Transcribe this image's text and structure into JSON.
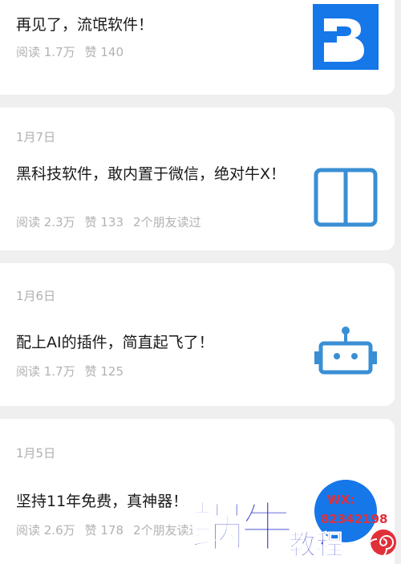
{
  "articles": [
    {
      "title": "再见了，流氓软件！",
      "reads": "阅读 1.7万",
      "likes": "赞 140",
      "thumbnail_icon": "blue-k-logo-icon"
    },
    {
      "date": "1月7日",
      "title": "黑科技软件，敢内置于微信，绝对牛X！",
      "reads": "阅读 2.3万",
      "likes": "赞 133",
      "friends": "2个朋友读过",
      "thumbnail_icon": "book-icon"
    },
    {
      "date": "1月6日",
      "title": "配上AI的插件，简直起飞了！",
      "reads": "阅读 1.7万",
      "likes": "赞 125",
      "thumbnail_icon": "robot-icon"
    },
    {
      "date": "1月5日",
      "title": "坚持11年免费，真神器！",
      "reads": "阅读 2.6万",
      "likes": "赞 178",
      "friends": "2个朋友读过",
      "thumbnail_icon": "blue-circle-icon"
    }
  ],
  "watermark": {
    "brand": "蜗牛",
    "sub": "教程",
    "contact": "WX:",
    "number": "82342198"
  },
  "colors": {
    "accent_blue": "#1677e8",
    "icon_blue": "#3a8fd4",
    "watermark_blue": "#2a33c8",
    "watermark_red": "#e0303a"
  }
}
